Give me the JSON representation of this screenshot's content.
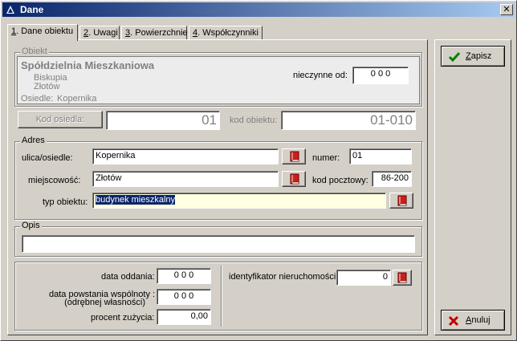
{
  "window": {
    "title": "Dane"
  },
  "tabs": [
    {
      "key": "1",
      "label": ". Dane obiektu"
    },
    {
      "key": "2",
      "label": ". Uwagi"
    },
    {
      "key": "3",
      "label": ". Powierzchnie"
    },
    {
      "key": "4",
      "label": ". Współczynniki"
    }
  ],
  "obiekt": {
    "group_label": "Obiekt",
    "name": "Spółdzielnia Mieszkaniowa",
    "line2": "Biskupia",
    "line3": "Złotów",
    "osiedle_label": "Osiedle:",
    "osiedle_value": "Kopernika",
    "nieczynne_label": "nieczynne od:",
    "nieczynne_value": "0 0 0",
    "kod_osiedla_button": "Kod osiedla:",
    "kod_osiedla_value": "01",
    "kod_obiektu_label": "kod obiektu:",
    "kod_obiektu_value": "01-010"
  },
  "adres": {
    "group_label": "Adres",
    "ulica_label": "ulica/osiedle:",
    "ulica_value": "Kopernika",
    "numer_label": "numer:",
    "numer_value": "01",
    "miejscowosc_label": "miejscowość:",
    "miejscowosc_value": "Złotów",
    "kod_pocztowy_label": "kod pocztowy:",
    "kod_pocztowy_value": "86-200",
    "typ_label": "typ obiektu:",
    "typ_value": "budynek mieszkalny"
  },
  "opis": {
    "group_label": "Opis",
    "value": ""
  },
  "bottom": {
    "data_oddania_label": "data oddania:",
    "data_oddania_value": "0 0 0",
    "data_powstania_label_1": "data powstania wspólnoty :",
    "data_powstania_label_2": "(odrębnej własności)",
    "data_powstania_value": "0 0 0",
    "procent_label": "procent zużycia:",
    "procent_value": "0,00",
    "identyfikator_label": "identyfikator nieruchomości",
    "identyfikator_value": "0"
  },
  "buttons": {
    "zapisz_key": "Z",
    "zapisz_rest": "apisz",
    "anuluj_key": "A",
    "anuluj_rest": "nuluj"
  },
  "colors": {
    "title_start": "#0a246a",
    "title_end": "#a6caf0",
    "highlight_field": "#ffffe1",
    "selection": "#0a246a",
    "zapisz_icon": "#008000",
    "anuluj_icon": "#c00000",
    "book_icon": "#c8201e"
  }
}
